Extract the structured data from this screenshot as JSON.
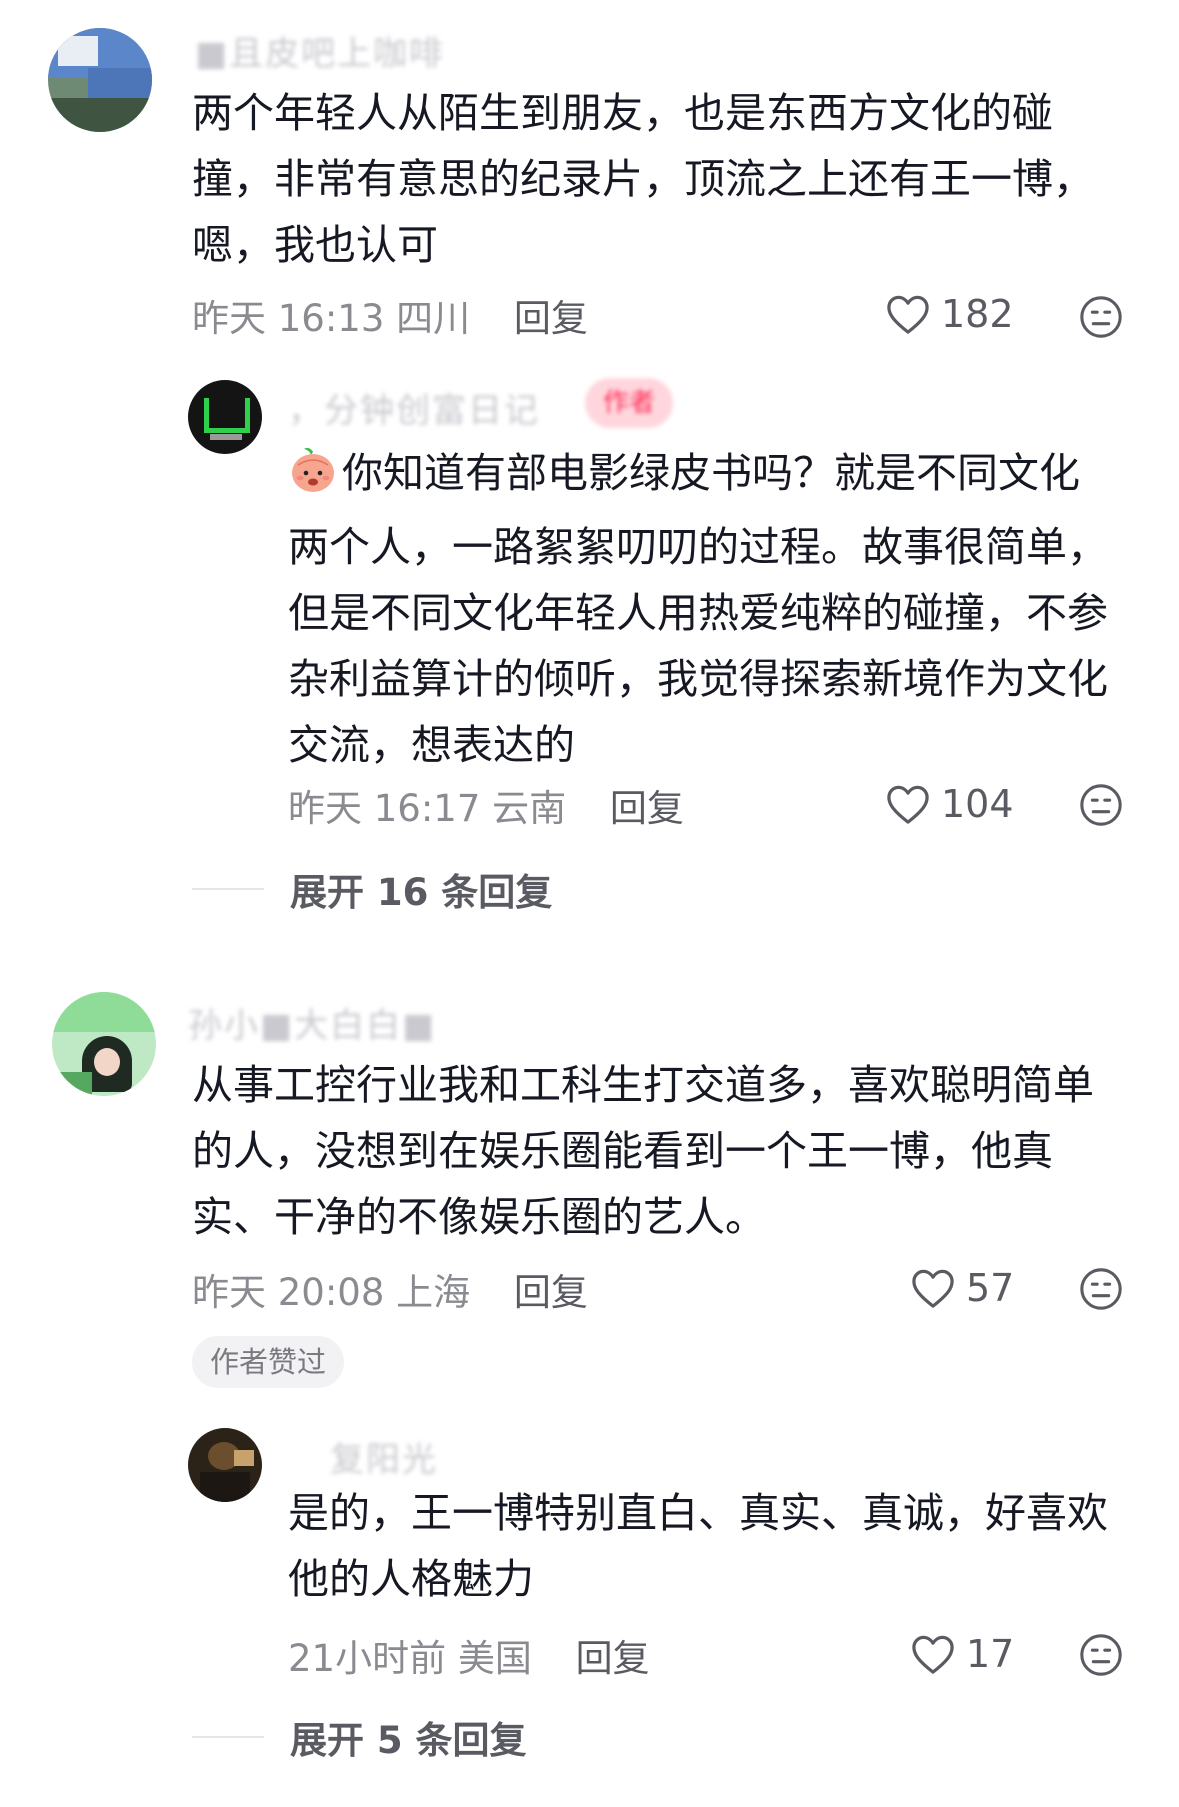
{
  "comments": [
    {
      "username": "■且皮吧上咖啡",
      "content_lines": [
        "两个年轻人从陌生到朋友，也是东西方文化的碰",
        "撞，非常有意思的纪录片，顶流之上还有王一博，",
        "嗯，我也认可"
      ],
      "time": "昨天 16:13",
      "location": "四川",
      "reply_label": "回复",
      "likes": "182",
      "reply": {
        "username": "，分钟创富日记",
        "author_tag": "作者",
        "sticker": "peach-emoji",
        "content_lines": [
          "你知道有部电影绿皮书吗？就是不同文化",
          "两个人，一路絮絮叨叨的过程。故事很简单，",
          "但是不同文化年轻人用热爱纯粹的碰撞，不参",
          "杂利益算计的倾听，我觉得探索新境作为文化",
          "交流，想表达的"
        ],
        "time": "昨天 16:17",
        "location": "云南",
        "reply_label": "回复",
        "likes": "104"
      },
      "expand_label": "展开 16 条回复"
    },
    {
      "username": "孙小■大白白■",
      "content_lines": [
        "从事工控行业我和工科生打交道多，喜欢聪明简单",
        "的人，没想到在娱乐圈能看到一个王一博，他真",
        "实、干净的不像娱乐圈的艺人。"
      ],
      "time": "昨天 20:08",
      "location": "上海",
      "reply_label": "回复",
      "likes": "57",
      "badge": "作者赞过",
      "reply": {
        "username": "复阳光",
        "content_lines": [
          "是的，王一博特别直白、真实、真诚，好喜欢",
          "他的人格魅力"
        ],
        "time": "21小时前",
        "location": "美国",
        "reply_label": "回复",
        "likes": "17"
      },
      "expand_label": "展开 5 条回复"
    }
  ],
  "colors": {
    "text": "#161823",
    "meta": "#8a8b91",
    "icon": "#5a5b62",
    "badge_bg": "#f2f2f4"
  }
}
